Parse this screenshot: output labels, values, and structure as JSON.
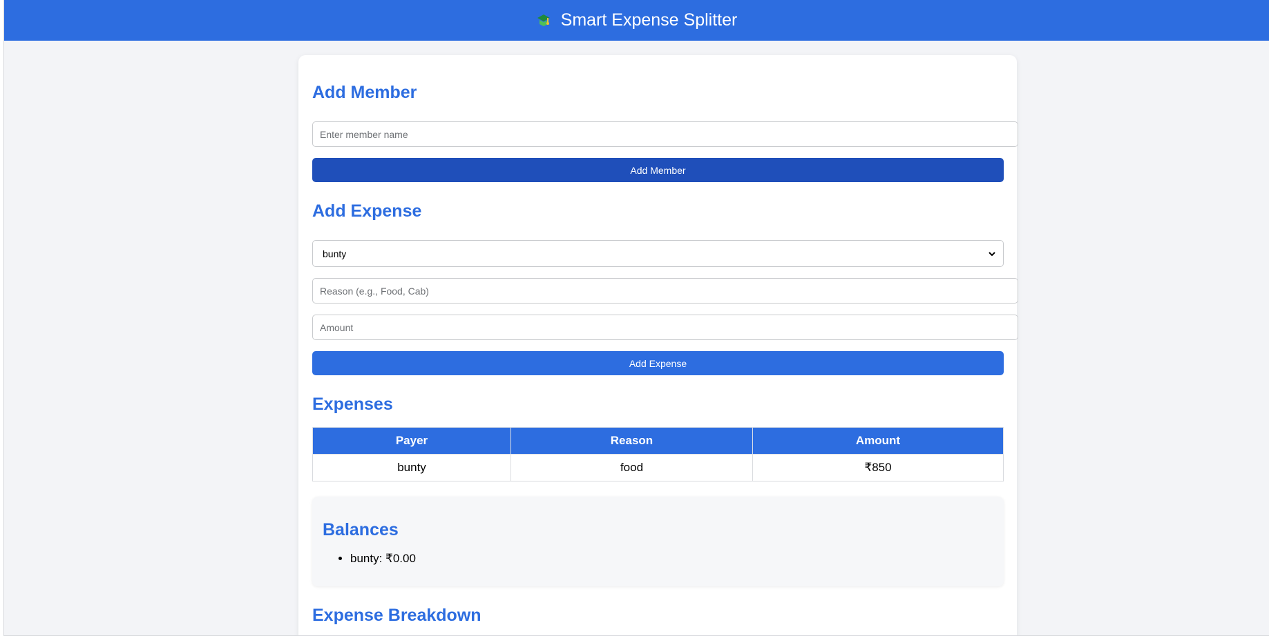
{
  "header": {
    "title": "Smart Expense Splitter",
    "logo_icon": "money-cap-icon"
  },
  "add_member": {
    "heading": "Add Member",
    "name_placeholder": "Enter member name",
    "button_label": "Add Member"
  },
  "add_expense": {
    "heading": "Add Expense",
    "payer_selected": "bunty",
    "reason_placeholder": "Reason (e.g., Food, Cab)",
    "amount_placeholder": "Amount",
    "button_label": "Add Expense"
  },
  "expenses": {
    "heading": "Expenses",
    "columns": [
      "Payer",
      "Reason",
      "Amount"
    ],
    "rows": [
      {
        "payer": "bunty",
        "reason": "food",
        "amount": "₹850"
      }
    ]
  },
  "balances": {
    "heading": "Balances",
    "items": [
      "bunty: ₹0.00"
    ]
  },
  "breakdown": {
    "heading": "Expense Breakdown"
  },
  "colors": {
    "primary": "#2d6de0",
    "primary_dark": "#1f4fba",
    "background": "#f3f4f7"
  }
}
